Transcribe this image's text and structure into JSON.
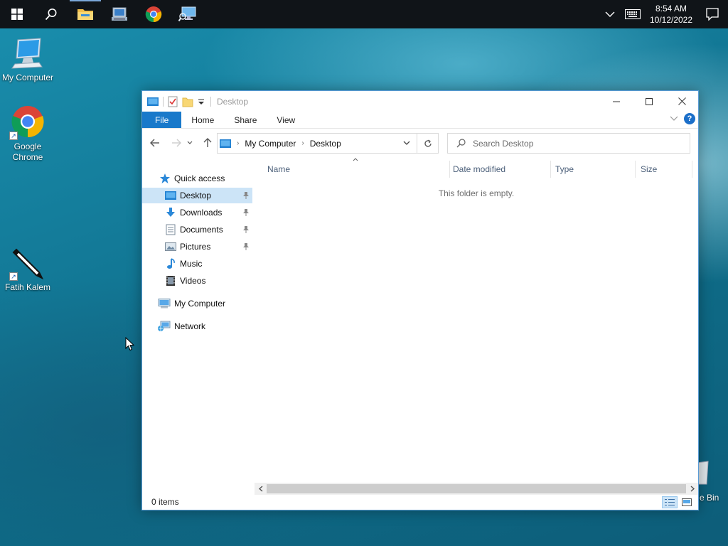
{
  "taskbar": {
    "clock_time": "8:54 AM",
    "clock_date": "10/12/2022",
    "pinned": [
      {
        "name": "file-explorer-icon",
        "active": true
      },
      {
        "name": "server-manager-icon",
        "active": false
      },
      {
        "name": "chrome-icon",
        "active": false
      },
      {
        "name": "my-computer-search-icon",
        "active": false
      }
    ]
  },
  "desktop": {
    "icons": [
      {
        "label": "My Computer",
        "icon": "monitor-icon"
      },
      {
        "label": "Google Chrome",
        "icon": "chrome-icon"
      },
      {
        "label": "Fatih Kalem",
        "icon": "pen-icon"
      }
    ],
    "recycle_partial_label": "e Bin"
  },
  "window": {
    "title": "Desktop",
    "ribbon_tabs": [
      "File",
      "Home",
      "Share",
      "View"
    ],
    "breadcrumb": [
      "My Computer",
      "Desktop"
    ],
    "search_placeholder": "Search Desktop",
    "nav": {
      "quick_access": "Quick access",
      "items": [
        {
          "label": "Desktop",
          "icon": "desktop-icon",
          "pinned": true,
          "selected": true
        },
        {
          "label": "Downloads",
          "icon": "downloads-icon",
          "pinned": true
        },
        {
          "label": "Documents",
          "icon": "documents-icon",
          "pinned": true
        },
        {
          "label": "Pictures",
          "icon": "pictures-icon",
          "pinned": true
        },
        {
          "label": "Music",
          "icon": "music-icon",
          "pinned": false
        },
        {
          "label": "Videos",
          "icon": "videos-icon",
          "pinned": false
        }
      ],
      "my_computer": "My Computer",
      "network": "Network"
    },
    "columns": [
      "Name",
      "Date modified",
      "Type",
      "Size"
    ],
    "empty_message": "This folder is empty.",
    "status_text": "0 items"
  },
  "colors": {
    "accent": "#1979ca",
    "selection": "#cce4f7",
    "taskbar": "#101418"
  }
}
